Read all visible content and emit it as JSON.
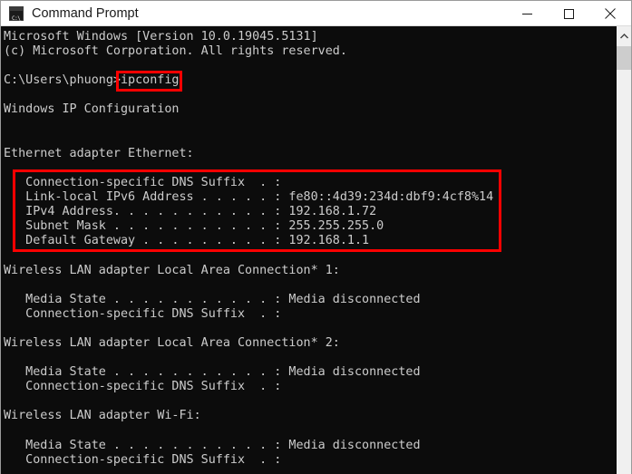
{
  "window": {
    "title": "Command Prompt",
    "app_icon": "console-icon",
    "icon_prompt_glyph": "C:\\",
    "controls": [
      {
        "name": "minimize-button",
        "label": "Minimize"
      },
      {
        "name": "maximize-button",
        "label": "Maximize"
      },
      {
        "name": "close-button",
        "label": "Close"
      }
    ]
  },
  "colors": {
    "terminal_background": "#0c0c0c",
    "terminal_foreground": "#cccccc",
    "titlebar_background": "#ffffff",
    "titlebar_foreground": "#1a1a1a",
    "annotation_red": "#fe0000",
    "scrollbar_track": "#f0f0f0",
    "scrollbar_thumb": "#cdcdcd"
  },
  "terminal": {
    "prompt": "C:\\Users\\phuong>",
    "command": "ipconfig",
    "output": "Microsoft Windows [Version 10.0.19045.5131]\n(c) Microsoft Corporation. All rights reserved.\n\nC:\\Users\\phuong>ipconfig\n\nWindows IP Configuration\n\n\nEthernet adapter Ethernet:\n\n   Connection-specific DNS Suffix  . :\n   Link-local IPv6 Address . . . . . : fe80::4d39:234d:dbf9:4cf8%14\n   IPv4 Address. . . . . . . . . . . : 192.168.1.72\n   Subnet Mask . . . . . . . . . . . : 255.255.255.0\n   Default Gateway . . . . . . . . . : 192.168.1.1\n\nWireless LAN adapter Local Area Connection* 1:\n\n   Media State . . . . . . . . . . . : Media disconnected\n   Connection-specific DNS Suffix  . :\n\nWireless LAN adapter Local Area Connection* 2:\n\n   Media State . . . . . . . . . . . : Media disconnected\n   Connection-specific DNS Suffix  . :\n\nWireless LAN adapter Wi-Fi:\n\n   Media State . . . . . . . . . . . : Media disconnected\n   Connection-specific DNS Suffix  . :",
    "lines": [
      "Microsoft Windows [Version 10.0.19045.5131]",
      "(c) Microsoft Corporation. All rights reserved.",
      "",
      "C:\\Users\\phuong>ipconfig",
      "",
      "Windows IP Configuration",
      "",
      "",
      "Ethernet adapter Ethernet:",
      "",
      "   Connection-specific DNS Suffix  . :",
      "   Link-local IPv6 Address . . . . . : fe80::4d39:234d:dbf9:4cf8%14",
      "   IPv4 Address. . . . . . . . . . . : 192.168.1.72",
      "   Subnet Mask . . . . . . . . . . . : 255.255.255.0",
      "   Default Gateway . . . . . . . . . : 192.168.1.1",
      "",
      "Wireless LAN adapter Local Area Connection* 1:",
      "",
      "   Media State . . . . . . . . . . . : Media disconnected",
      "   Connection-specific DNS Suffix  . :",
      "",
      "Wireless LAN adapter Local Area Connection* 2:",
      "",
      "   Media State . . . . . . . . . . . : Media disconnected",
      "   Connection-specific DNS Suffix  . :",
      "",
      "Wireless LAN adapter Wi-Fi:",
      "",
      "   Media State . . . . . . . . . . . : Media disconnected",
      "   Connection-specific DNS Suffix  . :"
    ],
    "banner": {
      "version_line": "Microsoft Windows [Version 10.0.19045.5131]",
      "copyright_line": "(c) Microsoft Corporation. All rights reserved."
    },
    "section_headings": [
      "Windows IP Configuration",
      "Ethernet adapter Ethernet:",
      "Wireless LAN adapter Local Area Connection* 1:",
      "Wireless LAN adapter Local Area Connection* 2:",
      "Wireless LAN adapter Wi-Fi:"
    ],
    "ethernet_adapter": {
      "dns_suffix_label": "Connection-specific DNS Suffix  . :",
      "dns_suffix_value": "",
      "ipv6_label": "Link-local IPv6 Address . . . . . :",
      "ipv6_value": "fe80::4d39:234d:dbf9:4cf8%14",
      "ipv4_label": "IPv4 Address. . . . . . . . . . . :",
      "ipv4_value": "192.168.1.72",
      "subnet_label": "Subnet Mask . . . . . . . . . . . :",
      "subnet_value": "255.255.255.0",
      "gateway_label": "Default Gateway . . . . . . . . . :",
      "gateway_value": "192.168.1.1"
    },
    "wireless_adapters": [
      {
        "heading": "Wireless LAN adapter Local Area Connection* 1:",
        "media_state_label": "Media State . . . . . . . . . . . :",
        "media_state_value": "Media disconnected",
        "dns_suffix_label": "Connection-specific DNS Suffix  . :",
        "dns_suffix_value": ""
      },
      {
        "heading": "Wireless LAN adapter Local Area Connection* 2:",
        "media_state_label": "Media State . . . . . . . . . . . :",
        "media_state_value": "Media disconnected",
        "dns_suffix_label": "Connection-specific DNS Suffix  . :",
        "dns_suffix_value": ""
      },
      {
        "heading": "Wireless LAN adapter Wi-Fi:",
        "media_state_label": "Media State . . . . . . . . . . . :",
        "media_state_value": "Media disconnected",
        "dns_suffix_label": "Connection-specific DNS Suffix  . :",
        "dns_suffix_value": ""
      }
    ]
  },
  "annotations": [
    {
      "name": "highlight-command",
      "target": "ipconfig",
      "color": "#fe0000"
    },
    {
      "name": "highlight-ethernet-details",
      "target": "Ethernet adapter details block",
      "color": "#fe0000"
    }
  ],
  "scrollbar": {
    "up_arrow": "chevron-up-icon",
    "thumb_label": "vertical-scroll-thumb"
  }
}
